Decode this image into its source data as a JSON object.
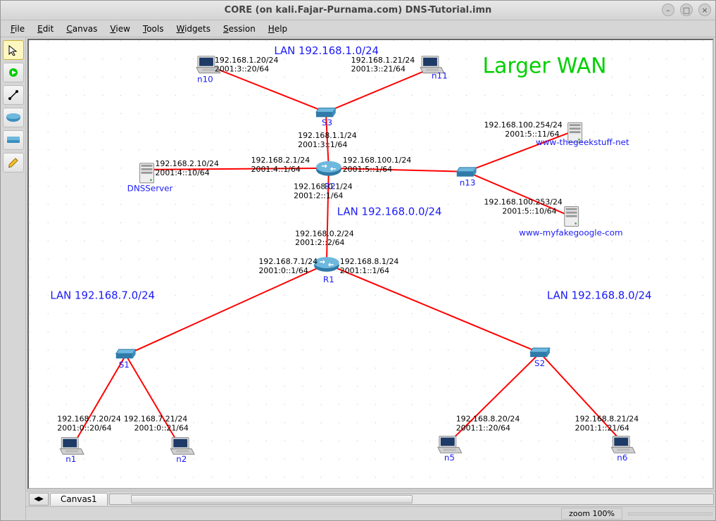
{
  "window": {
    "title": "CORE (on kali.Fajar-Purnama.com) DNS-Tutorial.imn"
  },
  "menu": {
    "file": "File",
    "edit": "Edit",
    "canvas": "Canvas",
    "view": "View",
    "tools": "Tools",
    "widgets": "Widgets",
    "session": "Session",
    "help": "Help"
  },
  "tabs": {
    "canvas1": "Canvas1"
  },
  "status": {
    "zoom": "zoom 100%"
  },
  "banner": {
    "title": "Larger WAN"
  },
  "lans": {
    "lan1": "LAN 192.168.1.0/24",
    "lan0": "LAN 192.168.0.0/24",
    "lan7": "LAN 192.168.7.0/24",
    "lan8": "LAN 192.168.8.0/24"
  },
  "nodes": {
    "n1": {
      "label": "n1",
      "ip": "192.168.7.20/24",
      "ip6": "2001:0::20/64"
    },
    "n2": {
      "label": "n2",
      "ip": "192.168.7.21/24",
      "ip6": "2001:0::21/64"
    },
    "n5": {
      "label": "n5",
      "ip": "192.168.8.20/24",
      "ip6": "2001:1::20/64"
    },
    "n6": {
      "label": "n6",
      "ip": "192.168.8.21/24",
      "ip6": "2001:1::21/64"
    },
    "n10": {
      "label": "n10",
      "ip": "192.168.1.20/24",
      "ip6": "2001:3::20/64"
    },
    "n11": {
      "label": "n11",
      "ip": "192.168.1.21/24",
      "ip6": "2001:3::21/64"
    },
    "n13_a": {
      "label": "www-thegeekstuff-net",
      "ip": "192.168.100.254/24",
      "ip6": "2001:5::11/64"
    },
    "n13_b": {
      "label": "www-myfakegoogle-com",
      "ip": "192.168.100.253/24",
      "ip6": "2001:5::10/64"
    },
    "dns": {
      "label": "DNSServer",
      "ip": "192.168.2.10/24",
      "ip6": "2001:4::10/64"
    },
    "s1": {
      "label": "S1"
    },
    "s2": {
      "label": "S2"
    },
    "s3": {
      "label": "S3"
    },
    "r1": {
      "label": "R1"
    },
    "r2": {
      "label": "R2"
    },
    "n13sw": {
      "label": "n13"
    }
  },
  "ifaces": {
    "r2_up": {
      "ip": "192.168.1.1/24",
      "ip6": "2001:3::1/64"
    },
    "r2_left": {
      "ip": "192.168.2.1/24",
      "ip6": "2001:4::1/64"
    },
    "r2_right": {
      "ip": "192.168.100.1/24",
      "ip6": "2001:5::1/64"
    },
    "r2_down": {
      "ip": "192.168.0.1/24",
      "ip6": "2001:2::1/64"
    },
    "r1_up": {
      "ip": "192.168.0.2/24",
      "ip6": "2001:2::2/64"
    },
    "r1_left": {
      "ip": "192.168.7.1/24",
      "ip6": "2001:0::1/64"
    },
    "r1_right": {
      "ip": "192.168.8.1/24",
      "ip6": "2001:1::1/64"
    }
  }
}
